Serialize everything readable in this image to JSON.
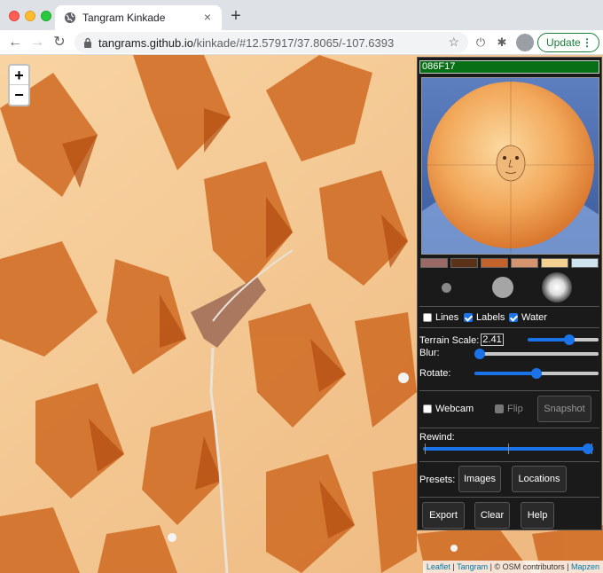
{
  "browser": {
    "tab_title": "Tangram Kinkade",
    "tab_close": "×",
    "new_tab": "+",
    "url_host": "tangrams.github.io",
    "url_path": "/kinkade/#12.57917/37.8065/-107.6393",
    "update_label": "Update",
    "update_menu": "⋮",
    "back_icon": "←",
    "forward_icon": "→",
    "reload_icon": "↻",
    "star_icon": "☆",
    "power_icon": "⏻",
    "puzzle_icon": "✱"
  },
  "map": {
    "zoom_in": "+",
    "zoom_out": "−",
    "attribution": {
      "leaflet": "Leaflet",
      "sep1": " | ",
      "tangram": "Tangram",
      "osm": " | © OSM contributors | ",
      "mapzen": "Mapzen"
    }
  },
  "panel": {
    "hex_value": "086F17",
    "swatch_colors": [
      "#9b6a66",
      "#5a3218",
      "#c3622a",
      "#d4956e",
      "#f3cf90",
      "#cfe3ef"
    ],
    "brush_sizes": [
      "small",
      "medium",
      "large"
    ],
    "toggles": {
      "lines": {
        "label": "Lines",
        "checked": false
      },
      "labels": {
        "label": "Labels",
        "checked": true
      },
      "water": {
        "label": "Water",
        "checked": true
      }
    },
    "terrain_scale_label": "Terrain Scale:",
    "terrain_scale_value": "2.41",
    "terrain_scale_fraction": 0.6,
    "blur_label": "Blur:",
    "blur_fraction": 0.0,
    "rotate_label": "Rotate:",
    "rotate_fraction": 0.5,
    "webcam_label": "Webcam",
    "webcam_checked": false,
    "flip_label": "Flip",
    "flip_checked": false,
    "snapshot_label": "Snapshot",
    "rewind_label": "Rewind:",
    "rewind_fraction": 1.0,
    "presets_label": "Presets:",
    "images_button": "Images",
    "locations_button": "Locations",
    "export_button": "Export",
    "clear_button": "Clear",
    "help_button": "Help"
  },
  "colors": {
    "accent": "#1a73e8",
    "hex_bg": "#086f17",
    "terrain_light": "#f6c992",
    "terrain_dark": "#c45a14"
  }
}
